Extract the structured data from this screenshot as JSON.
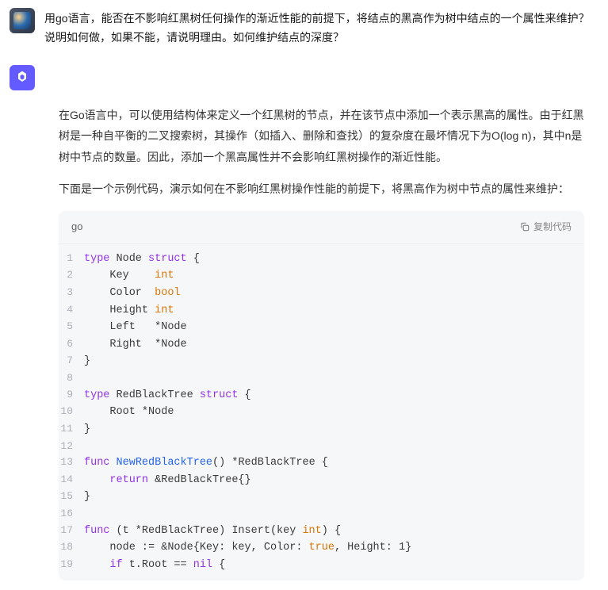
{
  "user": {
    "message": "用go语言，能否在不影响红黑树任何操作的渐近性能的前提下，将结点的黑高作为树中结点的一个属性来维护？说明如何做，如果不能，请说明理由。如何维护结点的深度？"
  },
  "ai": {
    "para1": "在Go语言中，可以使用结构体来定义一个红黑树的节点，并在该节点中添加一个表示黑高的属性。由于红黑树是一种自平衡的二叉搜索树，其操作（如插入、删除和查找）的复杂度在最坏情况下为O(log n)，其中n是树中节点的数量。因此，添加一个黑高属性并不会影响红黑树操作的渐近性能。",
    "para2": "下面是一个示例代码，演示如何在不影响红黑树操作性能的前提下，将黑高作为树中节点的属性来维护：",
    "code": {
      "lang": "go",
      "copy_label": "复制代码",
      "lines": [
        {
          "n": "1",
          "t": [
            {
              "c": "kw",
              "v": "type"
            },
            {
              "c": "",
              "v": " Node "
            },
            {
              "c": "kw",
              "v": "struct"
            },
            {
              "c": "",
              "v": " {"
            }
          ]
        },
        {
          "n": "2",
          "t": [
            {
              "c": "",
              "v": "    Key    "
            },
            {
              "c": "builtin",
              "v": "int"
            }
          ]
        },
        {
          "n": "3",
          "t": [
            {
              "c": "",
              "v": "    Color  "
            },
            {
              "c": "builtin",
              "v": "bool"
            }
          ]
        },
        {
          "n": "4",
          "t": [
            {
              "c": "",
              "v": "    Height "
            },
            {
              "c": "builtin",
              "v": "int"
            }
          ]
        },
        {
          "n": "5",
          "t": [
            {
              "c": "",
              "v": "    Left   *Node"
            }
          ]
        },
        {
          "n": "6",
          "t": [
            {
              "c": "",
              "v": "    Right  *Node"
            }
          ]
        },
        {
          "n": "7",
          "t": [
            {
              "c": "",
              "v": "}"
            }
          ]
        },
        {
          "n": "8",
          "t": [
            {
              "c": "",
              "v": ""
            }
          ]
        },
        {
          "n": "9",
          "t": [
            {
              "c": "kw",
              "v": "type"
            },
            {
              "c": "",
              "v": " RedBlackTree "
            },
            {
              "c": "kw",
              "v": "struct"
            },
            {
              "c": "",
              "v": " {"
            }
          ]
        },
        {
          "n": "10",
          "t": [
            {
              "c": "",
              "v": "    Root *Node"
            }
          ]
        },
        {
          "n": "11",
          "t": [
            {
              "c": "",
              "v": "}"
            }
          ]
        },
        {
          "n": "12",
          "t": [
            {
              "c": "",
              "v": ""
            }
          ]
        },
        {
          "n": "13",
          "t": [
            {
              "c": "kw",
              "v": "func"
            },
            {
              "c": "",
              "v": " "
            },
            {
              "c": "funcname",
              "v": "NewRedBlackTree"
            },
            {
              "c": "",
              "v": "() *RedBlackTree {"
            }
          ]
        },
        {
          "n": "14",
          "t": [
            {
              "c": "",
              "v": "    "
            },
            {
              "c": "kw",
              "v": "return"
            },
            {
              "c": "",
              "v": " &RedBlackTree{}"
            }
          ]
        },
        {
          "n": "15",
          "t": [
            {
              "c": "",
              "v": "}"
            }
          ]
        },
        {
          "n": "16",
          "t": [
            {
              "c": "",
              "v": ""
            }
          ]
        },
        {
          "n": "17",
          "t": [
            {
              "c": "kw",
              "v": "func"
            },
            {
              "c": "",
              "v": " (t *RedBlackTree) Insert(key "
            },
            {
              "c": "builtin",
              "v": "int"
            },
            {
              "c": "",
              "v": ") {"
            }
          ]
        },
        {
          "n": "18",
          "t": [
            {
              "c": "",
              "v": "    node := &Node{Key: key, Color: "
            },
            {
              "c": "boolval",
              "v": "true"
            },
            {
              "c": "",
              "v": ", Height: "
            },
            {
              "c": "num",
              "v": "1"
            },
            {
              "c": "",
              "v": "}"
            }
          ]
        },
        {
          "n": "19",
          "t": [
            {
              "c": "",
              "v": "    "
            },
            {
              "c": "kw",
              "v": "if"
            },
            {
              "c": "",
              "v": " t.Root == "
            },
            {
              "c": "kw",
              "v": "nil"
            },
            {
              "c": "",
              "v": " {"
            }
          ]
        }
      ]
    }
  }
}
